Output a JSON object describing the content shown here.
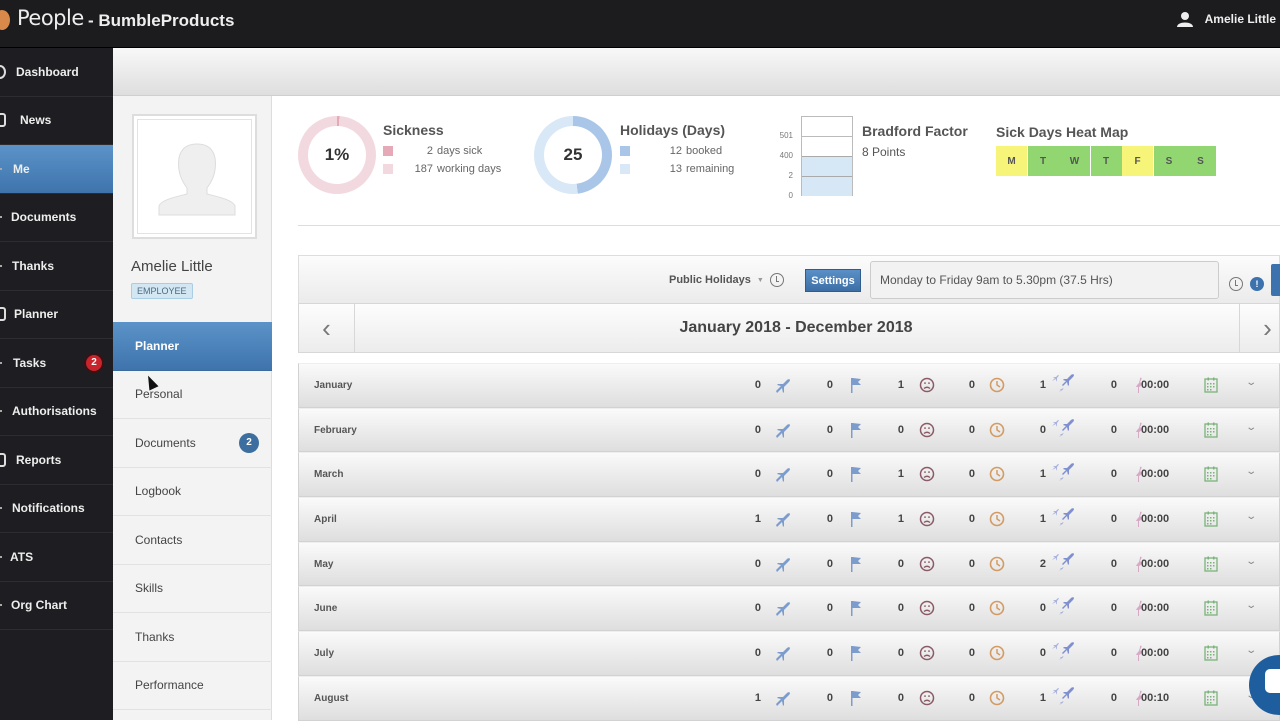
{
  "topbar": {
    "app_name": "People",
    "company": "- BumbleProducts",
    "user_name": "Amelie Little"
  },
  "sidebar": {
    "items": [
      {
        "label": "Dashboard",
        "icon": "dashboard-icon"
      },
      {
        "label": "News",
        "icon": "news-icon"
      },
      {
        "label": "Me",
        "icon": "me-icon",
        "active": true
      },
      {
        "label": "Documents",
        "icon": "documents-icon"
      },
      {
        "label": "Thanks",
        "icon": "thanks-icon"
      },
      {
        "label": "Planner",
        "icon": "planner-icon"
      },
      {
        "label": "Tasks",
        "icon": "tasks-icon",
        "badge": "2"
      },
      {
        "label": "Authorisations",
        "icon": "authorisations-icon"
      },
      {
        "label": "Reports",
        "icon": "reports-icon"
      },
      {
        "label": "Notifications",
        "icon": "notifications-icon"
      },
      {
        "label": "ATS",
        "icon": "ats-icon"
      },
      {
        "label": "Org Chart",
        "icon": "org-chart-icon"
      }
    ]
  },
  "profile": {
    "name": "Amelie Little",
    "role": "EMPLOYEE",
    "nav": [
      {
        "label": "Planner",
        "active": true
      },
      {
        "label": "Personal"
      },
      {
        "label": "Documents",
        "badge": "2"
      },
      {
        "label": "Logbook"
      },
      {
        "label": "Contacts"
      },
      {
        "label": "Skills"
      },
      {
        "label": "Thanks"
      },
      {
        "label": "Performance"
      }
    ]
  },
  "stats": {
    "sickness": {
      "title": "Sickness",
      "center": "1%",
      "percent": 1,
      "days_sick": "2",
      "days_sick_label": "days sick",
      "working_days": "187",
      "working_days_label": "working days",
      "color_primary": "#e6a9b8",
      "color_secondary": "#f2d9df"
    },
    "holidays": {
      "title": "Holidays (Days)",
      "center": "25",
      "booked": "12",
      "booked_label": "booked",
      "remaining": "13",
      "remaining_label": "remaining",
      "color_primary": "#a9c6e8",
      "color_secondary": "#d9e8f6"
    },
    "bradford": {
      "title": "Bradford Factor",
      "points": "8 Points",
      "ticks": [
        "501",
        "400",
        "2",
        "0"
      ]
    },
    "heatmap": {
      "title": "Sick Days Heat Map",
      "days": [
        {
          "label": "M",
          "color": "#f6f57a"
        },
        {
          "label": "T",
          "color": "#92d672"
        },
        {
          "label": "W",
          "color": "#92d672"
        },
        {
          "label": "T",
          "color": "#92d672"
        },
        {
          "label": "F",
          "color": "#f6f57a"
        },
        {
          "label": "S",
          "color": "#92d672"
        },
        {
          "label": "S",
          "color": "#92d672"
        }
      ]
    }
  },
  "toolbar": {
    "public_holidays": "Public Holidays",
    "settings": "Settings",
    "working_hours": "Monday to Friday 9am to 5.30pm (37.5 Hrs)",
    "info": "!"
  },
  "planner": {
    "period": "January 2018 - December 2018",
    "prev": "‹",
    "next": "›",
    "months": [
      {
        "name": "January",
        "holiday": "0",
        "flag": "0",
        "sick": "1",
        "late": "0",
        "trips": "1",
        "other": "0",
        "time": "00:00"
      },
      {
        "name": "February",
        "holiday": "0",
        "flag": "0",
        "sick": "0",
        "late": "0",
        "trips": "0",
        "other": "0",
        "time": "00:00"
      },
      {
        "name": "March",
        "holiday": "0",
        "flag": "0",
        "sick": "1",
        "late": "0",
        "trips": "1",
        "other": "0",
        "time": "00:00"
      },
      {
        "name": "April",
        "holiday": "1",
        "flag": "0",
        "sick": "1",
        "late": "0",
        "trips": "1",
        "other": "0",
        "time": "00:00"
      },
      {
        "name": "May",
        "holiday": "0",
        "flag": "0",
        "sick": "0",
        "late": "0",
        "trips": "2",
        "other": "0",
        "time": "00:00"
      },
      {
        "name": "June",
        "holiday": "0",
        "flag": "0",
        "sick": "0",
        "late": "0",
        "trips": "0",
        "other": "0",
        "time": "00:00"
      },
      {
        "name": "July",
        "holiday": "0",
        "flag": "0",
        "sick": "0",
        "late": "0",
        "trips": "0",
        "other": "0",
        "time": "00:00"
      },
      {
        "name": "August",
        "holiday": "1",
        "flag": "0",
        "sick": "0",
        "late": "0",
        "trips": "1",
        "other": "0",
        "time": "00:10"
      }
    ]
  }
}
